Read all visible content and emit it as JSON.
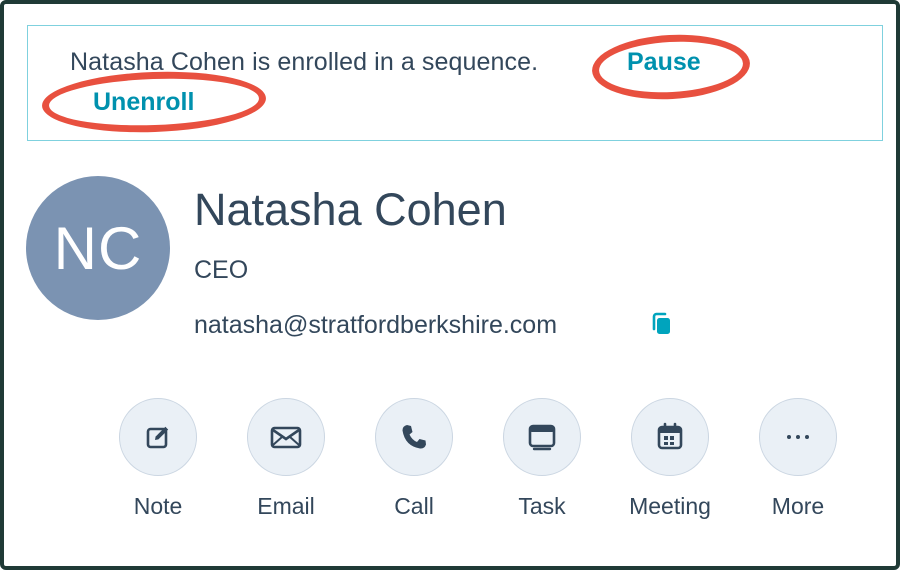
{
  "banner": {
    "message": "Natasha Cohen is enrolled in a sequence.",
    "pause_label": "Pause",
    "unenroll_label": "Unenroll",
    "highlight_color": "#e8503f",
    "border_color": "#7fd1de"
  },
  "contact": {
    "initials": "NC",
    "name": "Natasha Cohen",
    "title": "CEO",
    "email": "natasha@stratfordberkshire.com",
    "avatar_color": "#7b93b2"
  },
  "actions": [
    {
      "label": "Note",
      "icon": "note-icon"
    },
    {
      "label": "Email",
      "icon": "email-icon"
    },
    {
      "label": "Call",
      "icon": "call-icon"
    },
    {
      "label": "Task",
      "icon": "task-icon"
    },
    {
      "label": "Meeting",
      "icon": "meeting-icon"
    },
    {
      "label": "More",
      "icon": "more-icon"
    }
  ],
  "colors": {
    "text": "#33475b",
    "link": "#0091ae",
    "icon_circle_bg": "#eaf0f6",
    "icon": "#33475b",
    "copy_icon": "#00a4bd"
  }
}
